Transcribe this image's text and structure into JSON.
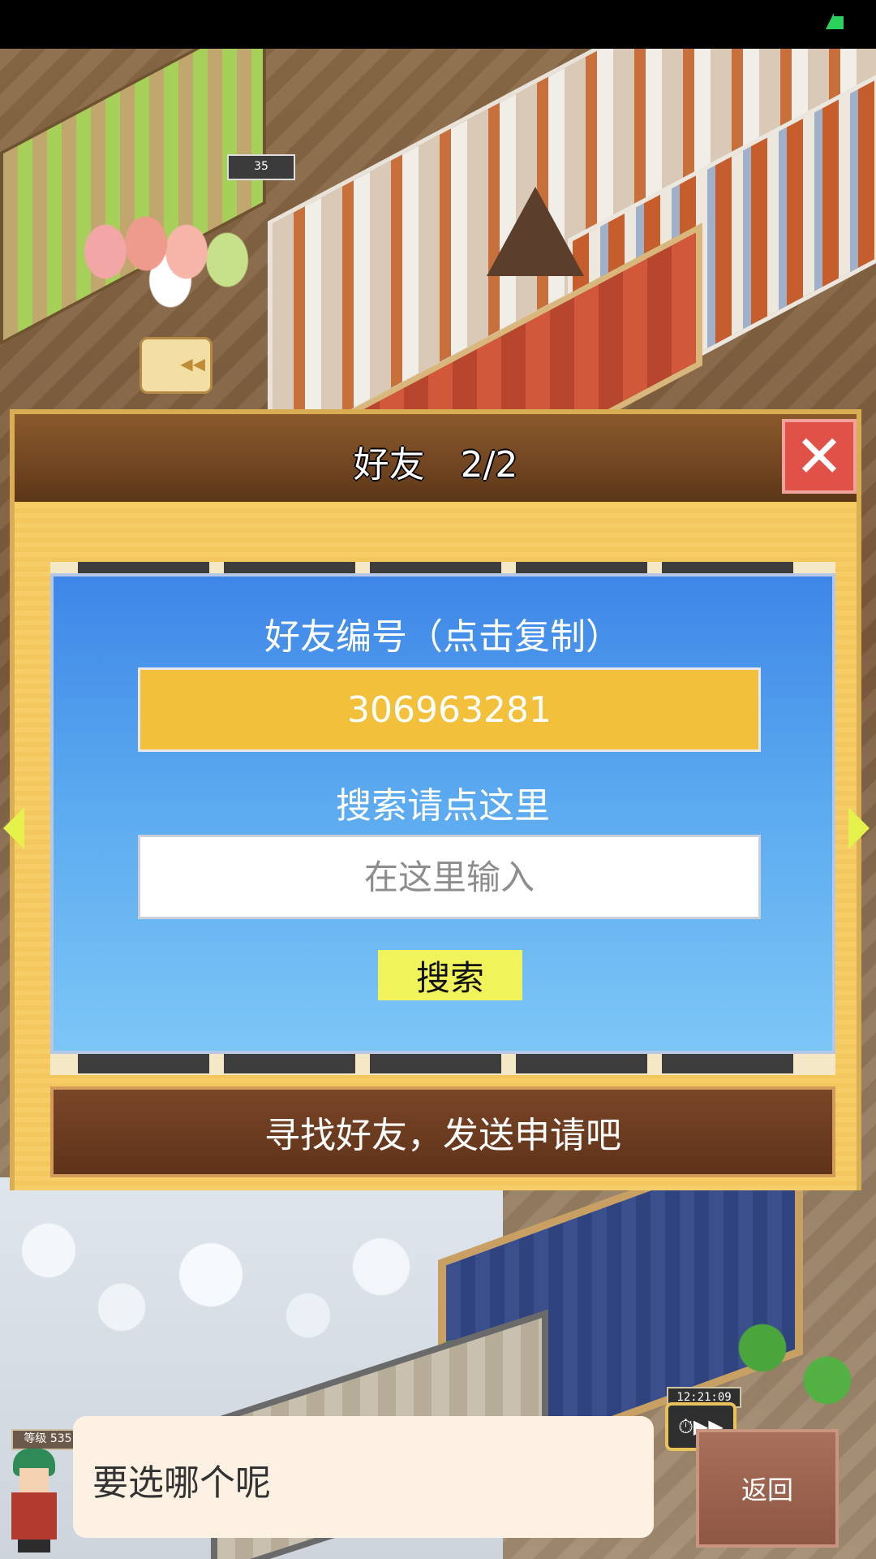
{
  "dialog": {
    "title": "好友　2/2",
    "friend_id_label": "好友编号（点击复制）",
    "friend_id": "306963281",
    "search_label": "搜索请点这里",
    "search_placeholder": "在这里输入",
    "search_button": "搜索",
    "send_request_button": "寻找好友，发送申请吧"
  },
  "world": {
    "level_flag": "35",
    "timer": "12:21:09",
    "player_level": "等级 535"
  },
  "bottom": {
    "message": "要选哪个呢",
    "back_button": "返回"
  },
  "icons": {
    "close": "close-icon",
    "fast_forward": "fast-forward-icon",
    "battery": "battery-icon",
    "prev": "arrow-left-icon",
    "next": "arrow-right-icon"
  },
  "colors": {
    "panel_blue": "#3e86e8",
    "id_box_yellow": "#f3c03c",
    "search_button_yellow": "#f0f35a",
    "close_red": "#e05248",
    "header_brown": "#714521"
  }
}
